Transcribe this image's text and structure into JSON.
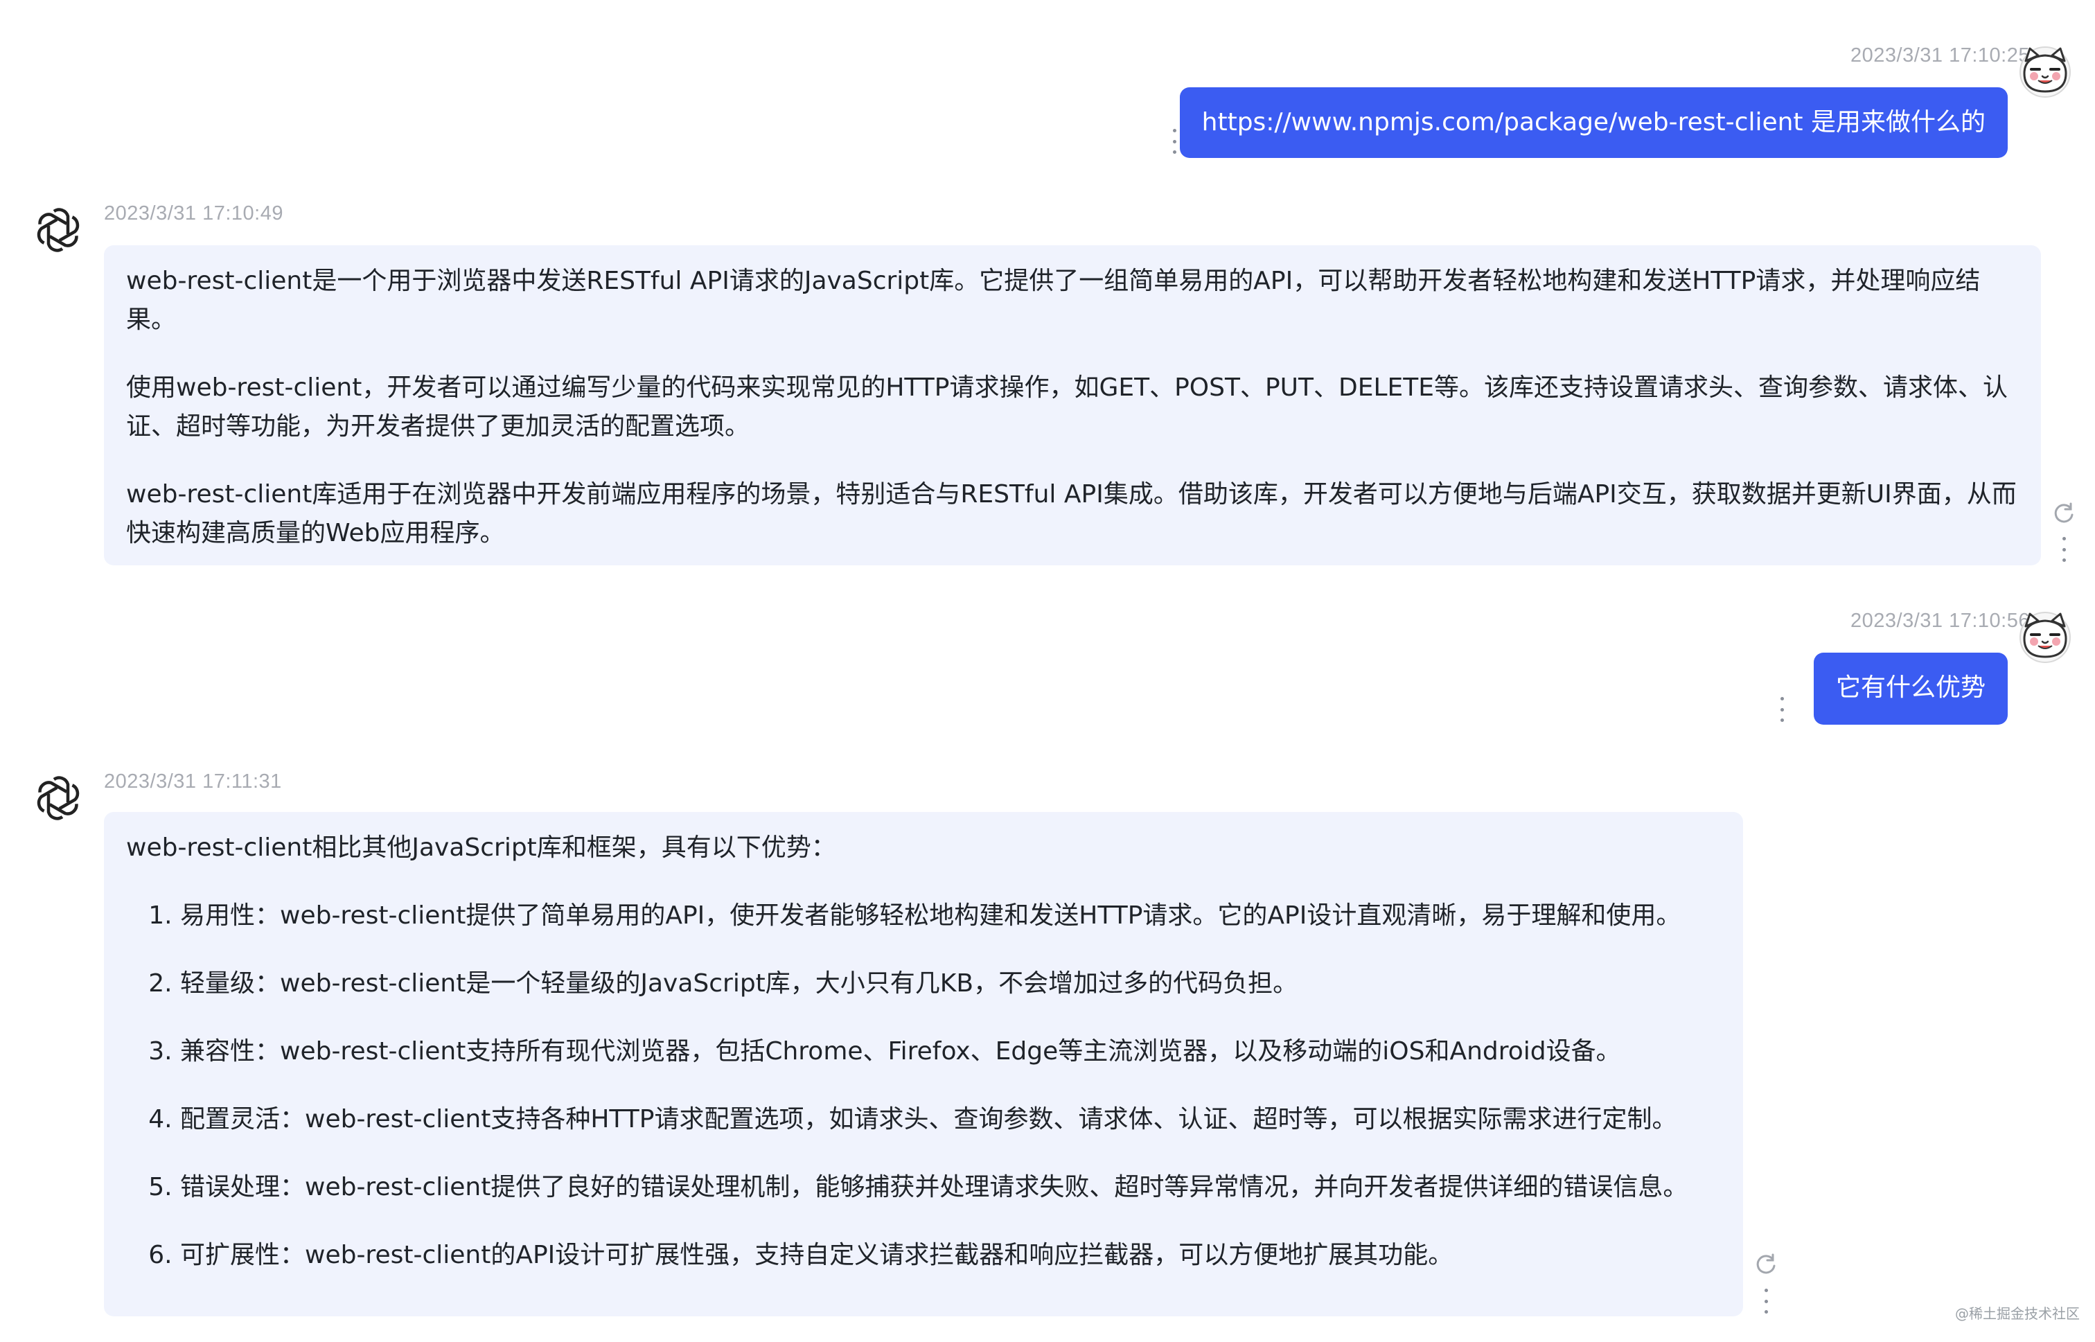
{
  "messages": [
    {
      "role": "user",
      "timestamp": "2023/3/31 17:10:25",
      "text": "https://www.npmjs.com/package/web-rest-client 是用来做什么的"
    },
    {
      "role": "assistant",
      "timestamp": "2023/3/31 17:10:49",
      "paragraphs": [
        "web-rest-client是一个用于浏览器中发送RESTful API请求的JavaScript库。它提供了一组简单易用的API，可以帮助开发者轻松地构建和发送HTTP请求，并处理响应结果。",
        "使用web-rest-client，开发者可以通过编写少量的代码来实现常见的HTTP请求操作，如GET、POST、PUT、DELETE等。该库还支持设置请求头、查询参数、请求体、认证、超时等功能，为开发者提供了更加灵活的配置选项。",
        "web-rest-client库适用于在浏览器中开发前端应用程序的场景，特别适合与RESTful API集成。借助该库，开发者可以方便地与后端API交互，获取数据并更新UI界面，从而快速构建高质量的Web应用程序。"
      ]
    },
    {
      "role": "user",
      "timestamp": "2023/3/31 17:10:56",
      "text": "它有什么优势"
    },
    {
      "role": "assistant",
      "timestamp": "2023/3/31 17:11:31",
      "intro": "web-rest-client相比其他JavaScript库和框架，具有以下优势：",
      "items": [
        "易用性：web-rest-client提供了简单易用的API，使开发者能够轻松地构建和发送HTTP请求。它的API设计直观清晰，易于理解和使用。",
        "轻量级：web-rest-client是一个轻量级的JavaScript库，大小只有几KB，不会增加过多的代码负担。",
        "兼容性：web-rest-client支持所有现代浏览器，包括Chrome、Firefox、Edge等主流浏览器，以及移动端的iOS和Android设备。",
        "配置灵活：web-rest-client支持各种HTTP请求配置选项，如请求头、查询参数、请求体、认证、超时等，可以根据实际需求进行定制。",
        "错误处理：web-rest-client提供了良好的错误处理机制，能够捕获并处理请求失败、超时等异常情况，并向开发者提供详细的错误信息。",
        "可扩展性：web-rest-client的API设计可扩展性强，支持自定义请求拦截器和响应拦截器，可以方便地扩展其功能。"
      ]
    }
  ],
  "icons": {
    "user_avatar": "cat-avatar-icon",
    "bot_avatar": "openai-logo-icon",
    "more": "more-vertical-icon",
    "regenerate": "refresh-icon"
  },
  "colors": {
    "user_bubble": "#3b5cf2",
    "bot_bubble": "#f0f3fd",
    "timestamp": "#a8abb2"
  },
  "watermark": "@稀土掘金技术社区"
}
